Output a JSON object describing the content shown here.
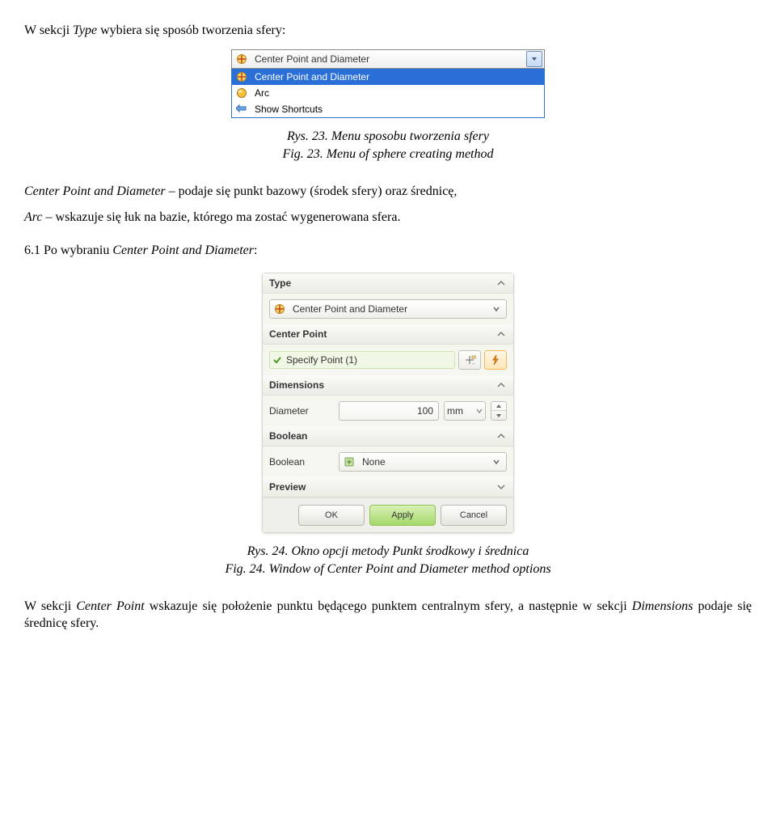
{
  "text": {
    "intro": "W sekcji ",
    "intro_type": "Type",
    "intro2": " wybiera się sposób tworzenia sfery:",
    "caption1a": "Rys. 23. Menu sposobu tworzenia sfery",
    "caption1b": "Fig. 23. Menu of sphere creating method",
    "cpd_desc_term": "Center Point and Diameter",
    "cpd_desc_rest": " – podaje się punkt bazowy (środek sfery) oraz średnicę,",
    "arc_term": "Arc",
    "arc_rest": " – wskazuje się łuk na bazie, którego ma zostać wygenerowana sfera.",
    "sec61a": "6.1  Po wybraniu ",
    "sec61b": "Center Point and Diameter",
    "sec61c": ":",
    "caption2a": "Rys. 24. Okno opcji metody Punkt środkowy i średnica",
    "caption2b": "Fig. 24. Window of Center Point and Diameter method options",
    "final1": "W sekcji ",
    "final2": "Center Point",
    "final3": " wskazuje się położenie punktu będącego punktem centralnym sfery, a następnie w sekcji ",
    "final4": "Dimensions",
    "final5": " podaje się średnicę sfery."
  },
  "dropdown": {
    "selected": "Center Point and Diameter",
    "items": [
      "Center Point and Diameter",
      "Arc",
      "Show Shortcuts"
    ]
  },
  "panel": {
    "groups": {
      "type": "Type",
      "centerpoint": "Center Point",
      "dimensions": "Dimensions",
      "boolean": "Boolean",
      "preview": "Preview"
    },
    "type_value": "Center Point and Diameter",
    "specify": "Specify Point (1)",
    "diameter_label": "Diameter",
    "diameter_value": "100",
    "unit": "mm",
    "boolean_label": "Boolean",
    "boolean_value": "None",
    "ok": "OK",
    "apply": "Apply",
    "cancel": "Cancel"
  }
}
